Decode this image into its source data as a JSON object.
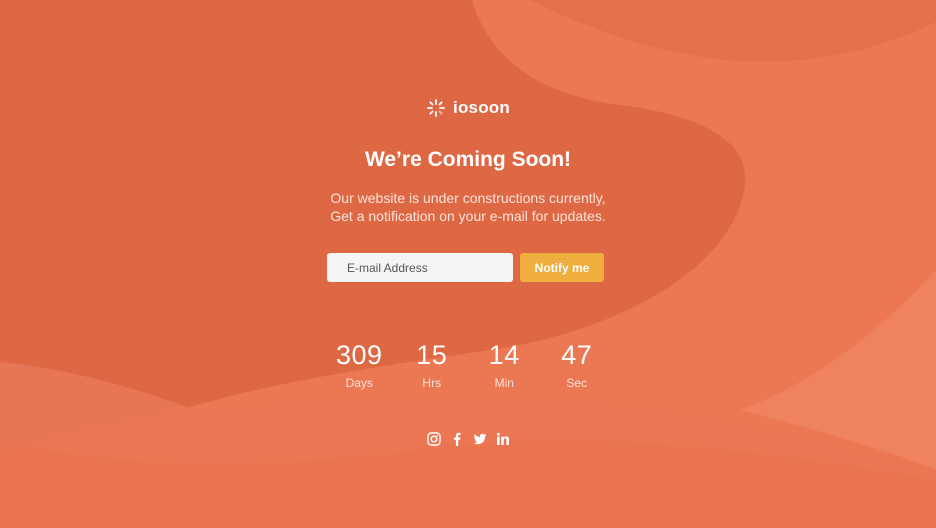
{
  "brand": {
    "name": "iosoon",
    "icon": "loader-icon"
  },
  "hero": {
    "title": "We’re Coming Soon!",
    "subtitle_line1": "Our website is under constructions currently,",
    "subtitle_line2": "Get a notification on your e-mail for updates."
  },
  "form": {
    "email_placeholder": "E-mail Address",
    "notify_label": "Notify me"
  },
  "countdown": [
    {
      "value": "309",
      "label": "Days"
    },
    {
      "value": "15",
      "label": "Hrs"
    },
    {
      "value": "14",
      "label": "Min"
    },
    {
      "value": "47",
      "label": "Sec"
    }
  ],
  "social": [
    "instagram-icon",
    "facebook-icon",
    "twitter-icon",
    "linkedin-icon"
  ],
  "colors": {
    "background": "#de6744",
    "wave_light": "#ee7b57",
    "button": "#efae3d",
    "input": "#f5f5f5"
  }
}
